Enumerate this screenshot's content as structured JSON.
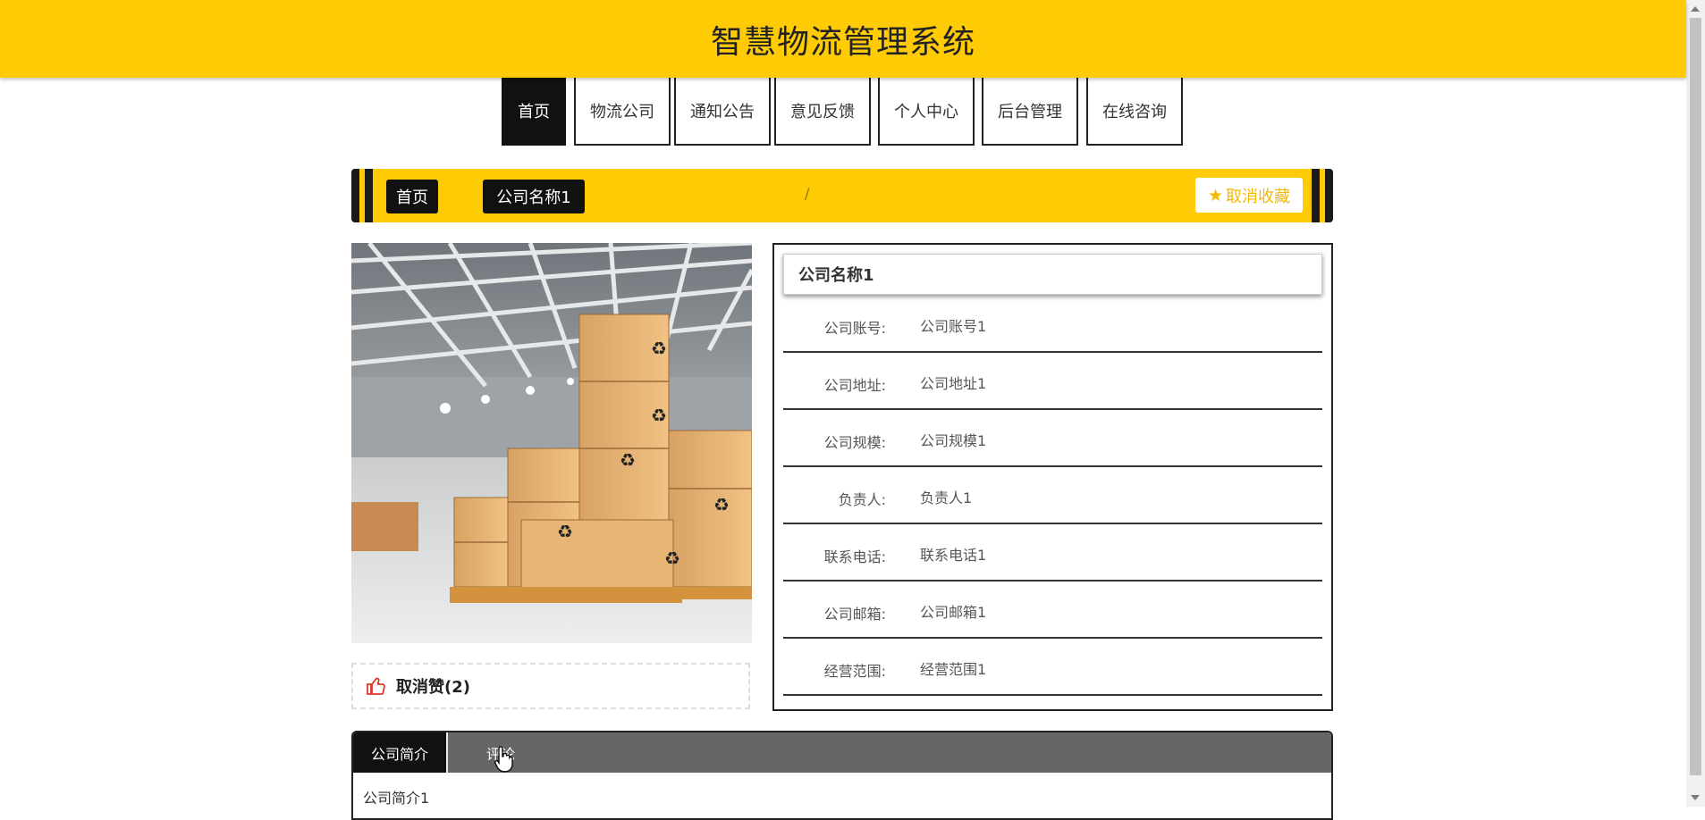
{
  "header": {
    "title": "智慧物流管理系统"
  },
  "nav": {
    "items": [
      {
        "label": "首页",
        "active": true
      },
      {
        "label": "物流公司"
      },
      {
        "label": "通知公告"
      },
      {
        "label": "意见反馈"
      },
      {
        "label": "个人中心"
      },
      {
        "label": "后台管理"
      },
      {
        "label": "在线咨询"
      }
    ]
  },
  "breadcrumb": {
    "home": "首页",
    "separator": "/",
    "current": "公司名称1"
  },
  "favorite": {
    "label": "取消收藏",
    "icon": "star-icon"
  },
  "like": {
    "label": "取消赞(2)",
    "icon": "thumbs-up-icon"
  },
  "info": {
    "title": "公司名称1",
    "fields": [
      {
        "label": "公司账号:",
        "value": "公司账号1"
      },
      {
        "label": "公司地址:",
        "value": "公司地址1"
      },
      {
        "label": "公司规模:",
        "value": "公司规模1"
      },
      {
        "label": "负责人:",
        "value": "负责人1"
      },
      {
        "label": "联系电话:",
        "value": "联系电话1"
      },
      {
        "label": "公司邮箱:",
        "value": "公司邮箱1"
      },
      {
        "label": "经营范围:",
        "value": "经营范围1"
      }
    ]
  },
  "tabs": {
    "items": [
      {
        "label": "公司简介",
        "active": true
      },
      {
        "label": "评论"
      }
    ],
    "content": "公司简介1"
  },
  "colors": {
    "accent": "#ffcb05",
    "dark": "#111111",
    "tab_bar": "#666666"
  }
}
